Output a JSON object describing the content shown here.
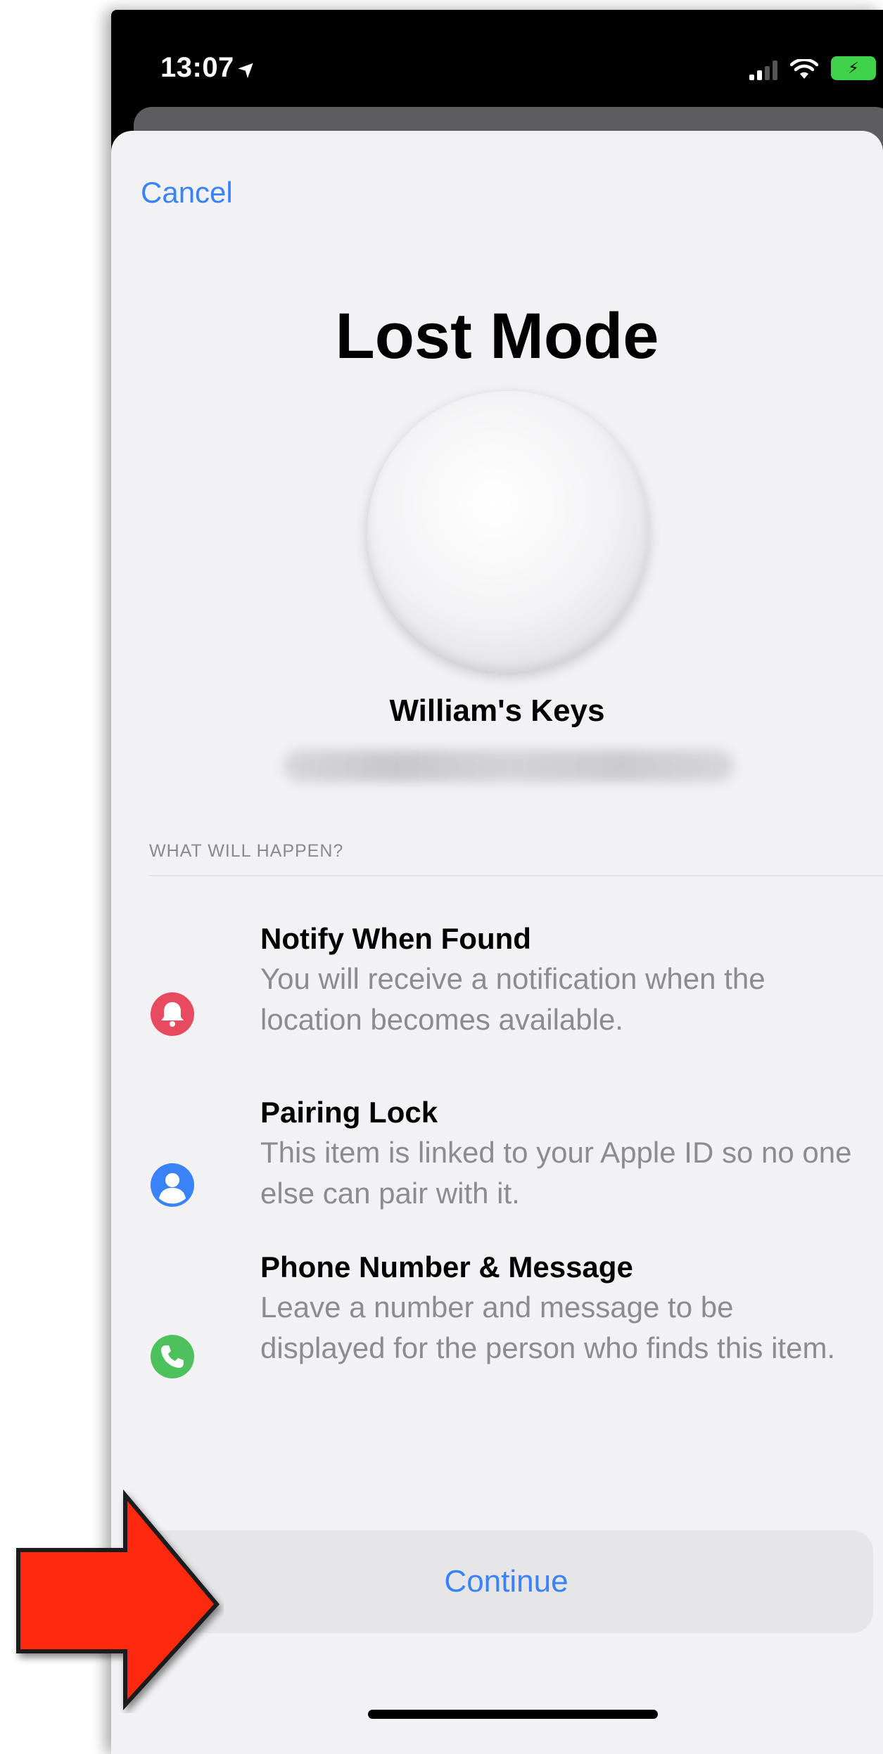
{
  "status_bar": {
    "time": "13:07",
    "location_arrow": "➤",
    "battery_glyph": "⚡"
  },
  "sheet": {
    "cancel_label": "Cancel",
    "title": "Lost Mode",
    "device_name": "William's Keys",
    "section_header": "WHAT WILL HAPPEN?",
    "features": [
      {
        "icon": "bell-icon",
        "icon_color": "#e84a5f",
        "title": "Notify When Found",
        "description": "You will receive a notification when the location becomes available."
      },
      {
        "icon": "person-icon",
        "icon_color": "#3a82f7",
        "title": "Pairing Lock",
        "description": "This item is linked to your Apple ID so no one else can pair with it."
      },
      {
        "icon": "phone-icon",
        "icon_color": "#4cc15c",
        "title": "Phone Number & Message",
        "description": "Leave a number and message to be displayed for the person who finds this item."
      }
    ],
    "continue_label": "Continue"
  },
  "colors": {
    "accent": "#3a82f7",
    "annotation_arrow": "#ff2a10"
  }
}
